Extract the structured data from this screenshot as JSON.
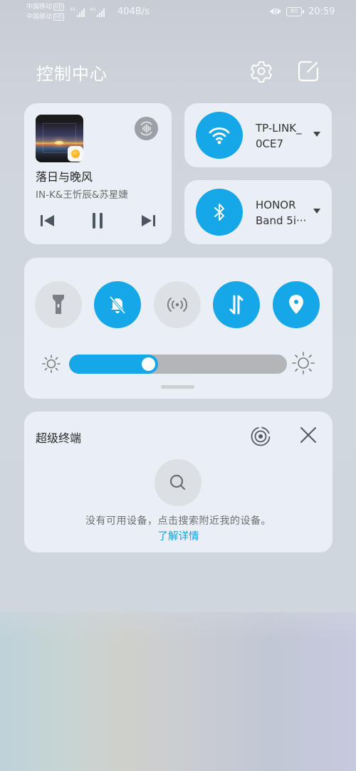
{
  "status_bar": {
    "carrier1": "中国移动",
    "carrier1_badge": "HD",
    "carrier2": "中国移动",
    "carrier2_badge": "HD",
    "sim1_network": "4G",
    "sim2_network": "4G",
    "net_speed": "404B/s",
    "battery": "80",
    "time": "20:59",
    "icons": [
      "eye-comfort-icon",
      "battery-icon"
    ]
  },
  "header": {
    "title": "控制中心",
    "settings_icon": "gear-icon",
    "edit_icon": "edit-icon"
  },
  "media": {
    "song_title": "落日与晚风",
    "artist": "IN-K&王忻辰&苏星婕",
    "playing": true,
    "controls": [
      "previous",
      "pause",
      "next"
    ]
  },
  "wifi": {
    "enabled": true,
    "name_line1": "TP-LINK_",
    "name_line2": "0CE7",
    "accent": "#16a7e8"
  },
  "bluetooth": {
    "enabled": true,
    "name_line1": "HONOR",
    "name_line2": "Band 5i···"
  },
  "toggles": [
    {
      "name": "flashlight",
      "icon": "flashlight-icon",
      "on": false
    },
    {
      "name": "silent-mode",
      "icon": "bell-off-icon",
      "on": true
    },
    {
      "name": "nfc-hotspot",
      "icon": "broadcast-icon",
      "on": false
    },
    {
      "name": "mobile-data",
      "icon": "data-transfer-icon",
      "on": true
    },
    {
      "name": "location",
      "icon": "location-pin-icon",
      "on": true
    }
  ],
  "brightness": {
    "value_percent": 35
  },
  "super_device": {
    "title": "超级终端",
    "empty_message": "没有可用设备，点击搜索附近我的设备。",
    "learn_more": "了解详情"
  },
  "colors": {
    "accent": "#16a7e8",
    "card_bg": "#eaeff5",
    "inactive_circle": "#dde1e6",
    "link": "#1a9fd8"
  }
}
